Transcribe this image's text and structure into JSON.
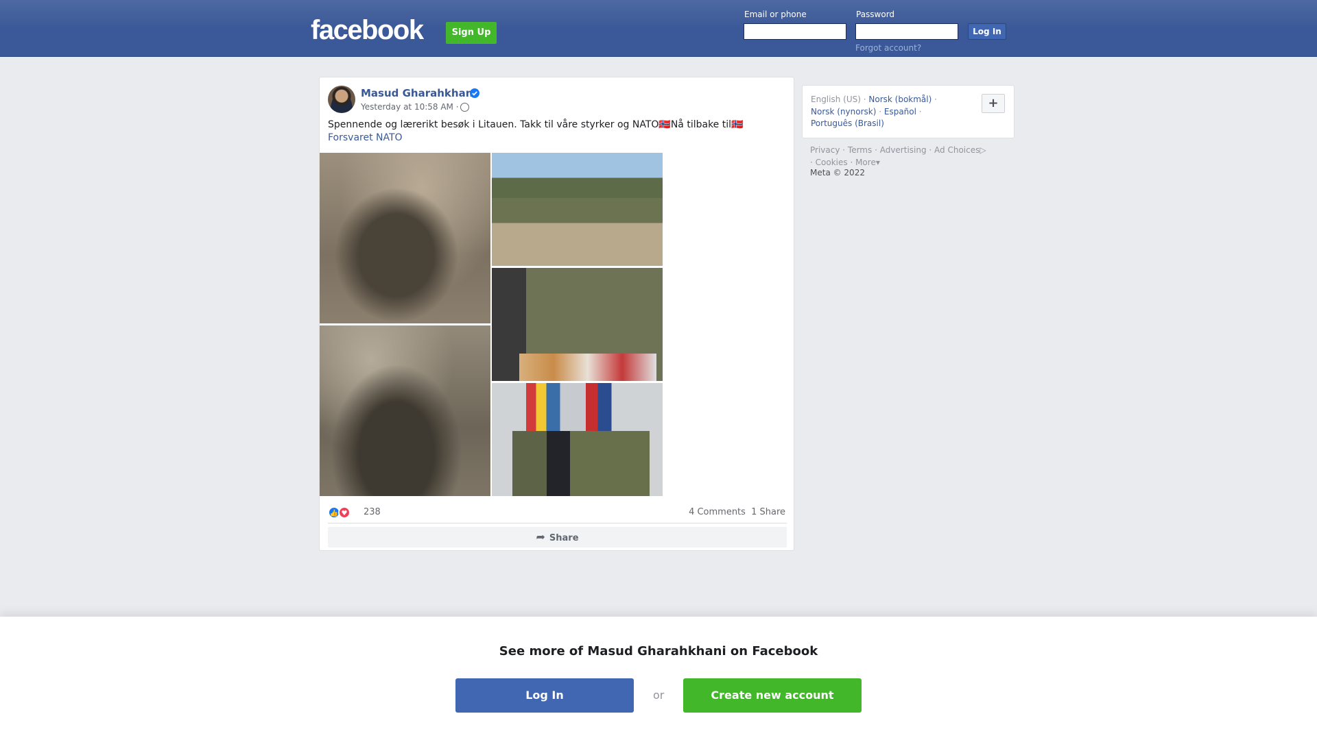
{
  "header": {
    "logo": "facebook",
    "signup_label": "Sign Up",
    "email_label": "Email or phone",
    "password_label": "Password",
    "login_label": "Log In",
    "forgot_label": "Forgot account?"
  },
  "post": {
    "author": "Masud Gharahkhani",
    "timestamp": "Yesterday at 10:58 AM ·",
    "text": "Spennende og lærerikt besøk i Litauen. Takk til våre styrker og NATO🇳🇴Nå tilbake til🇳🇴",
    "link_text": "Forsvaret NATO",
    "reaction_count": "238",
    "comments_label": "4 Comments",
    "shares_label": "1 Share",
    "share_button_label": "Share",
    "accent_color": "#385898"
  },
  "languages": {
    "current": "English (US)",
    "items": [
      "Norsk (bokmål)",
      "Norsk (nynorsk)",
      "Español",
      "Português (Brasil)"
    ]
  },
  "footer": {
    "links": [
      "Privacy",
      "Terms",
      "Advertising",
      "Ad Choices",
      "Cookies",
      "More"
    ],
    "copyright": "Meta © 2022"
  },
  "banner": {
    "title": "See more of Masud Gharahkhani on Facebook",
    "login_label": "Log In",
    "or_label": "or",
    "create_label": "Create new account"
  }
}
